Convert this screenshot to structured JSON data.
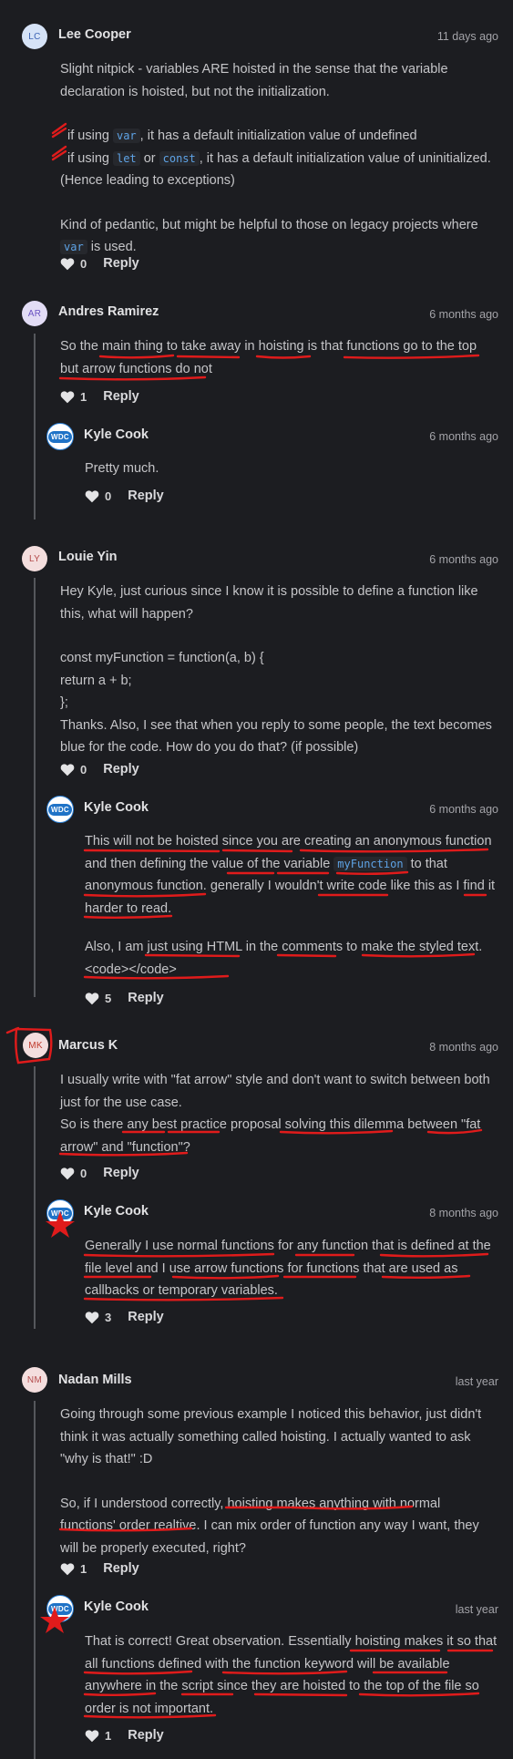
{
  "comments": [
    {
      "initials": "LC",
      "author": "Lee Cooper",
      "time": "11 days ago",
      "body": {
        "p1": "Slight nitpick - variables ARE hoisted in the sense that the variable declaration is hoisted, but not the initialization.",
        "b1_pre": "if using ",
        "b1_code": "var",
        "b1_post": ", it has a default initialization value of undefined",
        "b2_pre": "if using ",
        "b2_code1": "let",
        "b2_mid": " or ",
        "b2_code2": "const",
        "b2_post": ", it has a default initialization value of uninitialized.",
        "b3": "(Hence leading to exceptions)",
        "p3a": "Kind of pedantic, but might be helpful to those on legacy projects where",
        "p3_code": "var",
        "p3b": " is used."
      },
      "likes": "0",
      "reply_label": "Reply"
    },
    {
      "initials": "AR",
      "author": "Andres Ramirez",
      "time": "6 months ago",
      "body": {
        "l1": "So the main thing to take away in hoisting is that functions go to the top",
        "l2": "but arrow functions do not"
      },
      "likes": "1",
      "reply_label": "Reply",
      "reply": {
        "initials": "WDC",
        "author": "Kyle Cook",
        "time": "6 months ago",
        "body": "Pretty much.",
        "likes": "0",
        "reply_label": "Reply"
      }
    },
    {
      "initials": "LY",
      "author": "Louie Yin",
      "time": "6 months ago",
      "body": {
        "l1": "Hey Kyle, just curious since I know it is possible to define a function like",
        "l2": "this, what will happen?",
        "c1": "const myFunction = function(a, b) {",
        "c2": "return a + b;",
        "c3": "};",
        "l3": "Thanks. Also, I see that when you reply to some people, the text becomes",
        "l4": "blue for the code. How do you do that? (if possible)"
      },
      "likes": "0",
      "reply_label": "Reply",
      "reply": {
        "initials": "WDC",
        "author": "Kyle Cook",
        "time": "6 months ago",
        "body": {
          "l1": "This will not be hoisted since you are creating an anonymous function",
          "l2_pre": "and then defining the value of the variable ",
          "l2_code": "myFunction",
          "l2_post": " to that",
          "l3": "anonymous function. generally I wouldn't write code like this as I find it",
          "l4": "harder to read.",
          "l5": "Also, I am just using HTML in the comments to make the styled text.",
          "l6": "<code></code>"
        },
        "likes": "5",
        "reply_label": "Reply"
      }
    },
    {
      "initials": "MK",
      "author": "Marcus K",
      "time": "8 months ago",
      "body": {
        "l1": "I usually write with \"fat arrow\" style and don't want to switch between both",
        "l2": "just for the use case.",
        "l3": "So is there any best practice proposal solving this dilemma between \"fat",
        "l4": "arrow\" and \"function\"?"
      },
      "likes": "0",
      "reply_label": "Reply",
      "reply": {
        "initials": "WDC",
        "author": "Kyle Cook",
        "time": "8 months ago",
        "body": {
          "l1": "Generally I use normal functions for any function that is defined at the",
          "l2": "file level and I use arrow functions for functions that are used as",
          "l3": "callbacks or temporary variables."
        },
        "likes": "3",
        "reply_label": "Reply"
      }
    },
    {
      "initials": "NM",
      "author": "Nadan Mills",
      "time": "last year",
      "body": {
        "l1": "Going through some previous example I noticed this behavior, just didn't",
        "l2": "think it was actually something called hoisting. I actually wanted to ask",
        "l3": "\"why is that!\" :D",
        "l4": "So, if I understood correctly, hoisting makes anything with normal",
        "l5": "functions' order realtive. I can mix order of function any way I want, they",
        "l6": "will be properly executed, right?"
      },
      "likes": "1",
      "reply_label": "Reply",
      "reply": {
        "initials": "WDC",
        "author": "Kyle Cook",
        "time": "last year",
        "body": {
          "l1": "That is correct! Great observation. Essentially hoisting makes it so that",
          "l2": "all functions defined with the function keyword will be available",
          "l3": "anywhere in the script since they are hoisted to the top of the file so",
          "l4": "order is not important."
        },
        "likes": "1",
        "reply_label": "Reply"
      }
    }
  ],
  "icons": {
    "like": "heart-outline-icon",
    "wdc_badge": "wdc-logo"
  },
  "colors": {
    "background": "#1c1d21",
    "code": "#5ea3e6",
    "annotation": "#e01b1b"
  }
}
